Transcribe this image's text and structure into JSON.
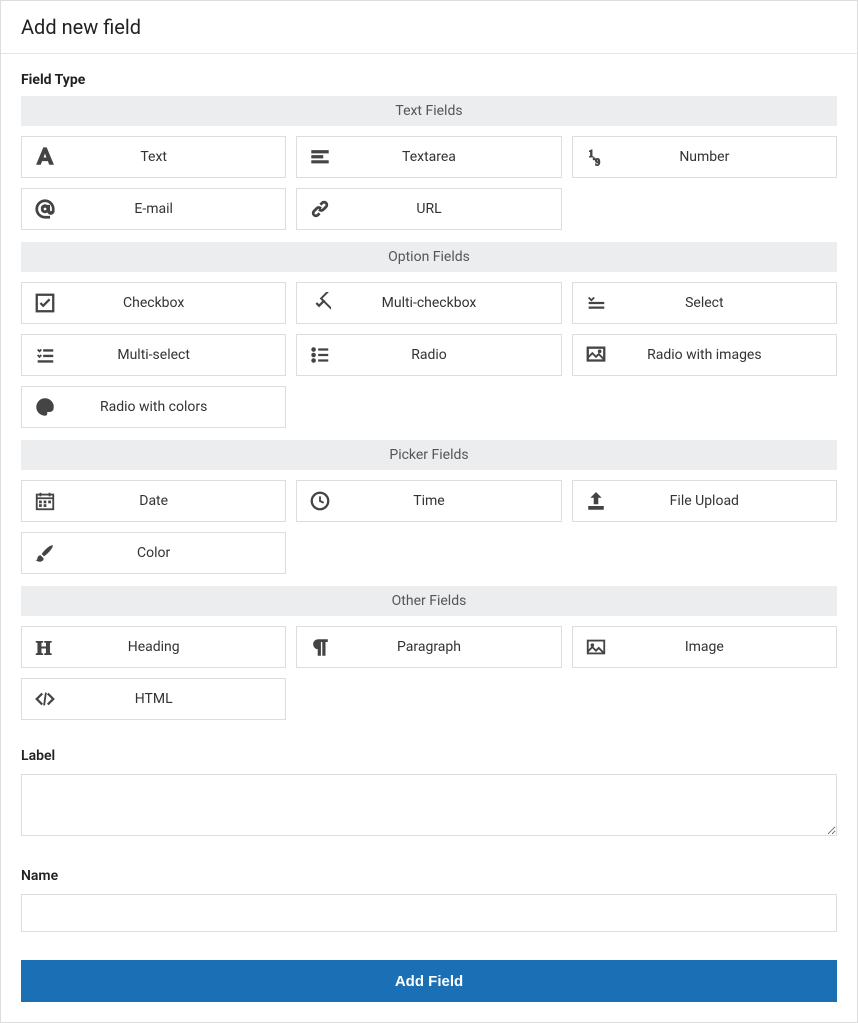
{
  "header": {
    "title": "Add new field"
  },
  "fieldTypeLabel": "Field Type",
  "groups": [
    {
      "title": "Text Fields",
      "items": [
        {
          "label": "Text",
          "icon": "font-icon"
        },
        {
          "label": "Textarea",
          "icon": "align-left-icon"
        },
        {
          "label": "Number",
          "icon": "number-icon"
        },
        {
          "label": "E-mail",
          "icon": "at-icon"
        },
        {
          "label": "URL",
          "icon": "link-icon"
        }
      ]
    },
    {
      "title": "Option Fields",
      "items": [
        {
          "label": "Checkbox",
          "icon": "checkbox-icon"
        },
        {
          "label": "Multi-checkbox",
          "icon": "multi-checkbox-icon"
        },
        {
          "label": "Select",
          "icon": "select-icon"
        },
        {
          "label": "Multi-select",
          "icon": "multi-select-icon"
        },
        {
          "label": "Radio",
          "icon": "radio-list-icon"
        },
        {
          "label": "Radio with images",
          "icon": "image-radio-icon"
        },
        {
          "label": "Radio with colors",
          "icon": "palette-icon"
        }
      ]
    },
    {
      "title": "Picker Fields",
      "items": [
        {
          "label": "Date",
          "icon": "calendar-icon"
        },
        {
          "label": "Time",
          "icon": "clock-icon"
        },
        {
          "label": "File Upload",
          "icon": "upload-icon"
        },
        {
          "label": "Color",
          "icon": "brush-icon"
        }
      ]
    },
    {
      "title": "Other Fields",
      "items": [
        {
          "label": "Heading",
          "icon": "heading-icon"
        },
        {
          "label": "Paragraph",
          "icon": "paragraph-icon"
        },
        {
          "label": "Image",
          "icon": "picture-icon"
        },
        {
          "label": "HTML",
          "icon": "code-icon"
        }
      ]
    }
  ],
  "form": {
    "labelField": {
      "label": "Label",
      "value": ""
    },
    "nameField": {
      "label": "Name",
      "value": ""
    },
    "submitLabel": "Add Field"
  }
}
